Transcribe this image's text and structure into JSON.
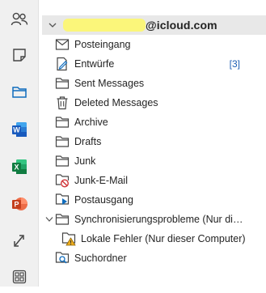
{
  "rail": {
    "items": [
      {
        "name": "contacts",
        "icon": "people-icon"
      },
      {
        "name": "notes",
        "icon": "note-icon"
      },
      {
        "name": "folders",
        "icon": "folder-icon"
      },
      {
        "name": "word",
        "icon": "word-icon",
        "letter": "W",
        "color": "#185abd"
      },
      {
        "name": "excel",
        "icon": "excel-icon",
        "letter": "X",
        "color": "#107c41"
      },
      {
        "name": "powerpoint",
        "icon": "powerpoint-icon",
        "letter": "P",
        "color": "#c43e1c"
      },
      {
        "name": "sync",
        "icon": "sync-icon"
      },
      {
        "name": "apps",
        "icon": "apps-icon"
      }
    ]
  },
  "account": {
    "label": "@icloud.com"
  },
  "folders": [
    {
      "label": "Posteingang",
      "icon": "inbox-icon"
    },
    {
      "label": "Entwürfe",
      "icon": "drafts-icon",
      "count": "[3]"
    },
    {
      "label": "Sent Messages",
      "icon": "folder-icon"
    },
    {
      "label": "Deleted Messages",
      "icon": "trash-icon"
    },
    {
      "label": "Archive",
      "icon": "folder-icon"
    },
    {
      "label": "Drafts",
      "icon": "folder-icon"
    },
    {
      "label": "Junk",
      "icon": "folder-icon"
    },
    {
      "label": "Junk-E-Mail",
      "icon": "junk-icon"
    },
    {
      "label": "Postausgang",
      "icon": "outbox-icon"
    },
    {
      "label": "Synchronisierungsprobleme (Nur dieser Computer)",
      "icon": "folder-icon",
      "expanded": true
    },
    {
      "label": "Lokale Fehler (Nur dieser Computer)",
      "icon": "warning-folder-icon",
      "sub": true
    },
    {
      "label": "Suchordner",
      "icon": "search-folder-icon"
    }
  ],
  "colors": {
    "accent": "#0f6cbd",
    "count": "#1e5fb4"
  }
}
